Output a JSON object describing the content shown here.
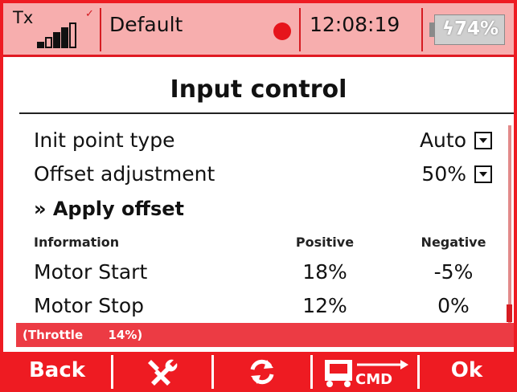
{
  "status": {
    "tx_label": "Tx",
    "model_name": "Default",
    "time": "12:08:19",
    "battery": "ϟ74%"
  },
  "title": "Input control",
  "rows": {
    "init_point": {
      "label": "Init point type",
      "value": "Auto"
    },
    "offset_adj": {
      "label": "Offset adjustment",
      "value": "50%"
    },
    "apply_offset": "» Apply offset"
  },
  "table": {
    "headers": [
      "Information",
      "Positive",
      "Negative"
    ],
    "rows": [
      {
        "name": "Motor Start",
        "positive": "18%",
        "negative": "-5%"
      },
      {
        "name": "Motor Stop",
        "positive": "12%",
        "negative": "0%"
      }
    ]
  },
  "live": {
    "channel": "(Throttle",
    "value": "14%)"
  },
  "softkeys": {
    "back": "Back",
    "ok": "Ok",
    "cmd": "CMD"
  },
  "colors": {
    "accent": "#ee1b22",
    "status_bg": "#f7aeae",
    "strip": "#ec3b44"
  },
  "icons": [
    "signal-bars-icon",
    "record-dot-icon",
    "battery-icon",
    "tools-icon",
    "refresh-icon",
    "transmitter-cmd-icon",
    "dropdown-arrow-icon"
  ]
}
